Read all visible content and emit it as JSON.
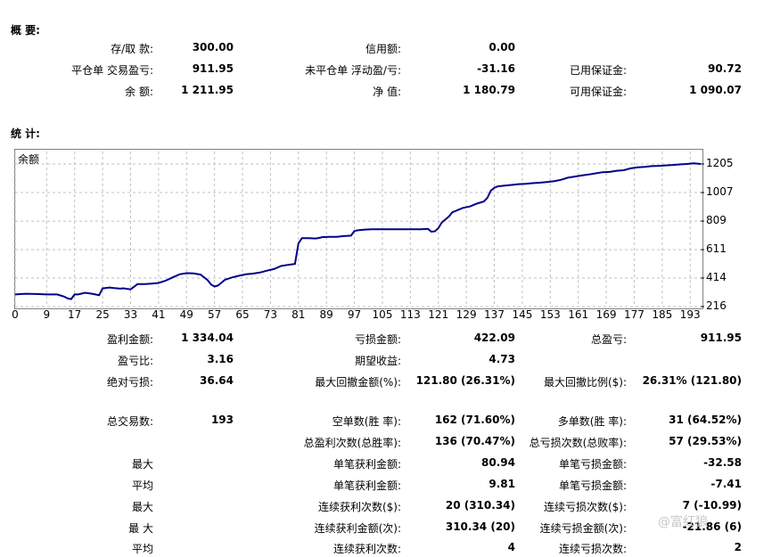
{
  "summary": {
    "title": "概 要:",
    "rows": [
      [
        [
          "存/取 款:",
          "300.00"
        ],
        [
          "信用额:",
          "0.00"
        ],
        [
          "",
          ""
        ]
      ],
      [
        [
          "平仓单 交易盈亏:",
          "911.95"
        ],
        [
          "未平仓单 浮动盈/亏:",
          "-31.16"
        ],
        [
          "已用保证金:",
          "90.72"
        ]
      ],
      [
        [
          "余 额:",
          "1 211.95"
        ],
        [
          "净 值:",
          "1 180.79"
        ],
        [
          "可用保证金:",
          "1 090.07"
        ]
      ]
    ]
  },
  "stats_title": "统 计:",
  "chart_data": {
    "type": "line",
    "title": "余额",
    "x_ticks": [
      "0",
      "9",
      "17",
      "25",
      "33",
      "41",
      "49",
      "57",
      "65",
      "73",
      "81",
      "89",
      "97",
      "105",
      "113",
      "121",
      "129",
      "137",
      "145",
      "153",
      "161",
      "169",
      "177",
      "185",
      "193"
    ],
    "y_ticks": [
      "1205",
      "1007",
      "809",
      "611",
      "414",
      "216"
    ],
    "ylim": [
      216,
      1205
    ],
    "xlim": [
      0,
      196
    ],
    "grid": true,
    "color": "#00008b",
    "x": [
      0,
      3,
      6,
      9,
      12,
      14,
      15,
      16,
      17,
      18,
      20,
      22,
      24,
      25,
      26,
      27,
      28,
      30,
      31,
      33,
      35,
      37,
      39,
      41,
      43,
      45,
      47,
      49,
      51,
      53,
      55,
      56,
      57,
      58,
      60,
      62,
      64,
      66,
      68,
      70,
      72,
      74,
      76,
      78,
      80,
      81,
      82,
      84,
      86,
      88,
      90,
      92,
      94,
      96,
      97,
      98,
      100,
      102,
      104,
      106,
      108,
      110,
      112,
      114,
      116,
      118,
      119,
      120,
      121,
      122,
      124,
      125,
      126,
      128,
      130,
      132,
      134,
      135,
      136,
      137,
      138,
      140,
      142,
      144,
      146,
      148,
      150,
      152,
      154,
      156,
      158,
      160,
      162,
      164,
      166,
      168,
      170,
      172,
      174,
      176,
      178,
      180,
      182,
      184,
      186,
      188,
      190,
      192,
      194,
      196
    ],
    "y": [
      300,
      305,
      303,
      300,
      300,
      285,
      272,
      268,
      300,
      300,
      312,
      305,
      295,
      342,
      345,
      348,
      345,
      340,
      343,
      335,
      372,
      372,
      375,
      380,
      395,
      418,
      440,
      448,
      446,
      438,
      400,
      370,
      355,
      362,
      402,
      418,
      430,
      440,
      445,
      452,
      465,
      476,
      497,
      505,
      512,
      655,
      690,
      690,
      688,
      698,
      700,
      700,
      705,
      708,
      740,
      745,
      750,
      752,
      752,
      752,
      752,
      752,
      752,
      752,
      752,
      755,
      735,
      738,
      760,
      800,
      840,
      870,
      880,
      900,
      910,
      930,
      945,
      970,
      1020,
      1040,
      1050,
      1055,
      1060,
      1065,
      1068,
      1072,
      1075,
      1080,
      1085,
      1095,
      1110,
      1118,
      1125,
      1132,
      1140,
      1148,
      1150,
      1158,
      1162,
      1175,
      1182,
      1185,
      1190,
      1192,
      1195,
      1198,
      1202,
      1205,
      1210,
      1205
    ]
  },
  "stats": [
    [
      [
        "盈利金额:",
        "1 334.04"
      ],
      [
        "亏损金额:",
        "422.09"
      ],
      [
        "总盈亏:",
        "911.95"
      ]
    ],
    [
      [
        "盈亏比:",
        "3.16"
      ],
      [
        "期望收益:",
        "4.73"
      ],
      [
        "",
        ""
      ]
    ],
    [
      [
        "绝对亏损:",
        "36.64"
      ],
      [
        "最大回撤金额(%):",
        "121.80 (26.31%)"
      ],
      [
        "最大回撤比例($):",
        "26.31% (121.80)"
      ]
    ],
    [
      [
        "总交易数:",
        "193"
      ],
      [
        "空单数(胜 率):",
        "162 (71.60%)"
      ],
      [
        "多单数(胜 率):",
        "31 (64.52%)"
      ]
    ],
    [
      [
        "",
        ""
      ],
      [
        "总盈利次数(总胜率):",
        "136 (70.47%)"
      ],
      [
        "总亏损次数(总败率):",
        "57 (29.53%)"
      ]
    ],
    [
      [
        "最大",
        ""
      ],
      [
        "单笔获利金额:",
        "80.94"
      ],
      [
        "单笔亏损金额:",
        "-32.58"
      ]
    ],
    [
      [
        "平均",
        ""
      ],
      [
        "单笔获利金额:",
        "9.81"
      ],
      [
        "单笔亏损金额:",
        "-7.41"
      ]
    ],
    [
      [
        "最大",
        ""
      ],
      [
        "连续获利次数($):",
        "20 (310.34)"
      ],
      [
        "连续亏损次数($):",
        "7 (-10.99)"
      ]
    ],
    [
      [
        "最 大",
        ""
      ],
      [
        "连续获利金额(次):",
        "310.34 (20)"
      ],
      [
        "连续亏损金额(次):",
        "-21.86 (6)"
      ]
    ],
    [
      [
        "平均",
        ""
      ],
      [
        "连续获利次数:",
        "4"
      ],
      [
        "连续亏损次数:",
        "2"
      ]
    ]
  ],
  "watermark": "@富红狼"
}
